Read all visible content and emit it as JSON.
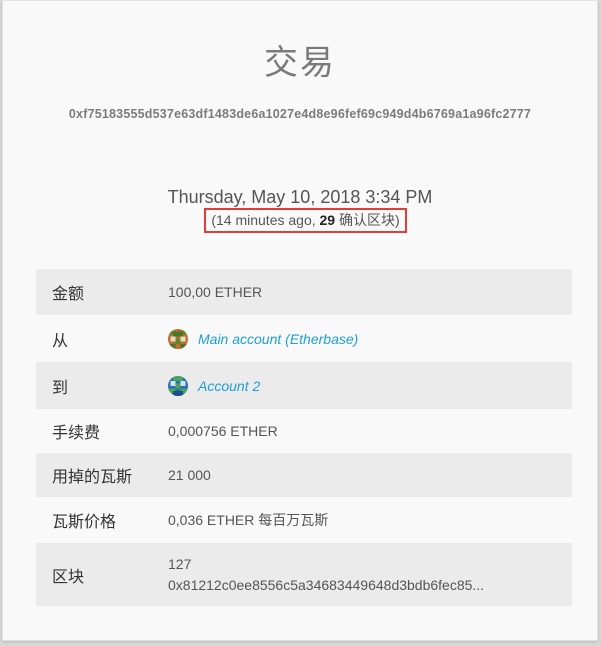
{
  "title": "交易",
  "tx_hash": "0xf75183555d537e63df1483de6a1027e4d8e96fef69c949d4b6769a1a96fc2777",
  "datetime": "Thursday, May 10, 2018 3:34 PM",
  "confirm": {
    "open_paren": "(",
    "ago": "14 minutes ago, ",
    "count": "29",
    "label": " 确认区块",
    "close_paren": ")"
  },
  "details": {
    "amount": {
      "label": "金额",
      "value": "100,00 ETHER"
    },
    "from": {
      "label": "从",
      "account_name": "Main account (Etherbase)",
      "icon": "identicon-green-orange"
    },
    "to": {
      "label": "到",
      "account_name": "Account 2",
      "icon": "identicon-blue-green"
    },
    "fee": {
      "label": "手续费",
      "value": "0,000756 ETHER"
    },
    "gas_used": {
      "label": "用掉的瓦斯",
      "value": "21 000"
    },
    "gas_price": {
      "label": "瓦斯价格",
      "value": "0,036 ETHER 每百万瓦斯"
    },
    "block": {
      "label": "区块",
      "number": "127",
      "hash": "0x81212c0ee8556c5a34683449648d3bdb6fec85..."
    }
  },
  "colors": {
    "link": "#1f9fd6",
    "highlight_border": "#e53a3a",
    "shaded_row": "#ebebeb"
  }
}
